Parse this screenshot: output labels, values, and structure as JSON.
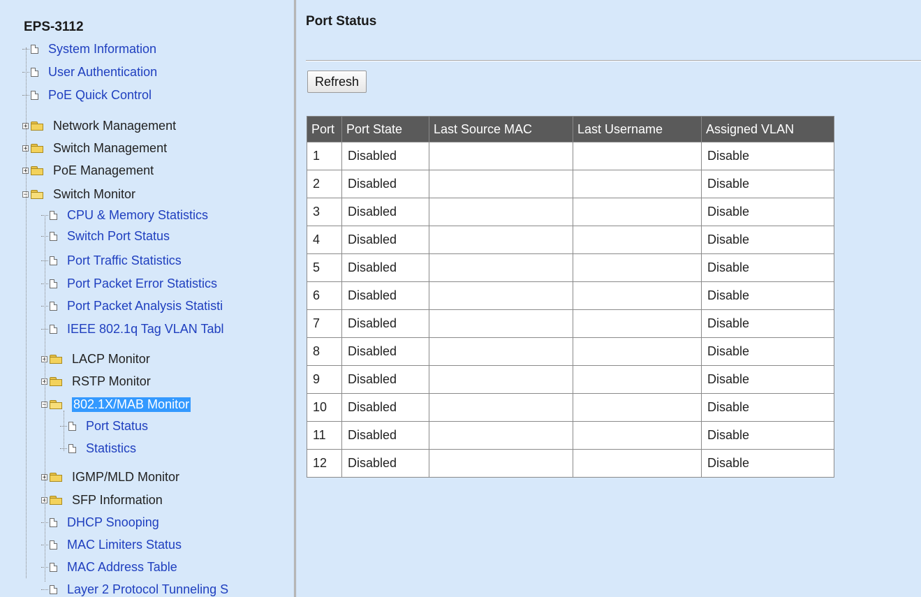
{
  "sidebar": {
    "device_title": "EPS-3112",
    "items": [
      {
        "label": "System Information",
        "type": "link"
      },
      {
        "label": "User Authentication",
        "type": "link"
      },
      {
        "label": "PoE Quick Control",
        "type": "link"
      },
      {
        "label": "Network Management",
        "type": "folder",
        "state": "collapsed"
      },
      {
        "label": "Switch Management",
        "type": "folder",
        "state": "collapsed"
      },
      {
        "label": "PoE Management",
        "type": "folder",
        "state": "collapsed"
      },
      {
        "label": "Switch Monitor",
        "type": "folder",
        "state": "expanded"
      },
      {
        "label": "CPU & Memory Statistics",
        "type": "link"
      },
      {
        "label": "Switch Port Status",
        "type": "link"
      },
      {
        "label": "Port Traffic Statistics",
        "type": "link"
      },
      {
        "label": "Port Packet Error Statistics",
        "type": "link"
      },
      {
        "label": "Port Packet Analysis Statisti",
        "type": "link"
      },
      {
        "label": "IEEE 802.1q Tag VLAN Tabl",
        "type": "link"
      },
      {
        "label": "LACP Monitor",
        "type": "folder",
        "state": "collapsed"
      },
      {
        "label": "RSTP Monitor",
        "type": "folder",
        "state": "collapsed"
      },
      {
        "label": "802.1X/MAB Monitor",
        "type": "folder",
        "state": "expanded",
        "selected": true
      },
      {
        "label": "Port Status",
        "type": "link"
      },
      {
        "label": "Statistics",
        "type": "link"
      },
      {
        "label": "IGMP/MLD Monitor",
        "type": "folder",
        "state": "collapsed"
      },
      {
        "label": "SFP Information",
        "type": "folder",
        "state": "collapsed"
      },
      {
        "label": "DHCP Snooping",
        "type": "link"
      },
      {
        "label": "MAC Limiters Status",
        "type": "link"
      },
      {
        "label": "MAC Address Table",
        "type": "link"
      },
      {
        "label": "Layer 2 Protocol Tunneling S",
        "type": "link"
      }
    ]
  },
  "main": {
    "title": "Port Status",
    "refresh_label": "Refresh",
    "table": {
      "headers": [
        "Port",
        "Port State",
        "Last Source MAC",
        "Last Username",
        "Assigned VLAN"
      ],
      "rows": [
        [
          "1",
          "Disabled",
          "",
          "",
          "Disable"
        ],
        [
          "2",
          "Disabled",
          "",
          "",
          "Disable"
        ],
        [
          "3",
          "Disabled",
          "",
          "",
          "Disable"
        ],
        [
          "4",
          "Disabled",
          "",
          "",
          "Disable"
        ],
        [
          "5",
          "Disabled",
          "",
          "",
          "Disable"
        ],
        [
          "6",
          "Disabled",
          "",
          "",
          "Disable"
        ],
        [
          "7",
          "Disabled",
          "",
          "",
          "Disable"
        ],
        [
          "8",
          "Disabled",
          "",
          "",
          "Disable"
        ],
        [
          "9",
          "Disabled",
          "",
          "",
          "Disable"
        ],
        [
          "10",
          "Disabled",
          "",
          "",
          "Disable"
        ],
        [
          "11",
          "Disabled",
          "",
          "",
          "Disable"
        ],
        [
          "12",
          "Disabled",
          "",
          "",
          "Disable"
        ]
      ]
    }
  },
  "colors": {
    "background": "#d7e8fa",
    "link": "#1f3fbf",
    "header_bg": "#5a5a5a",
    "selected_bg": "#3399ff"
  }
}
